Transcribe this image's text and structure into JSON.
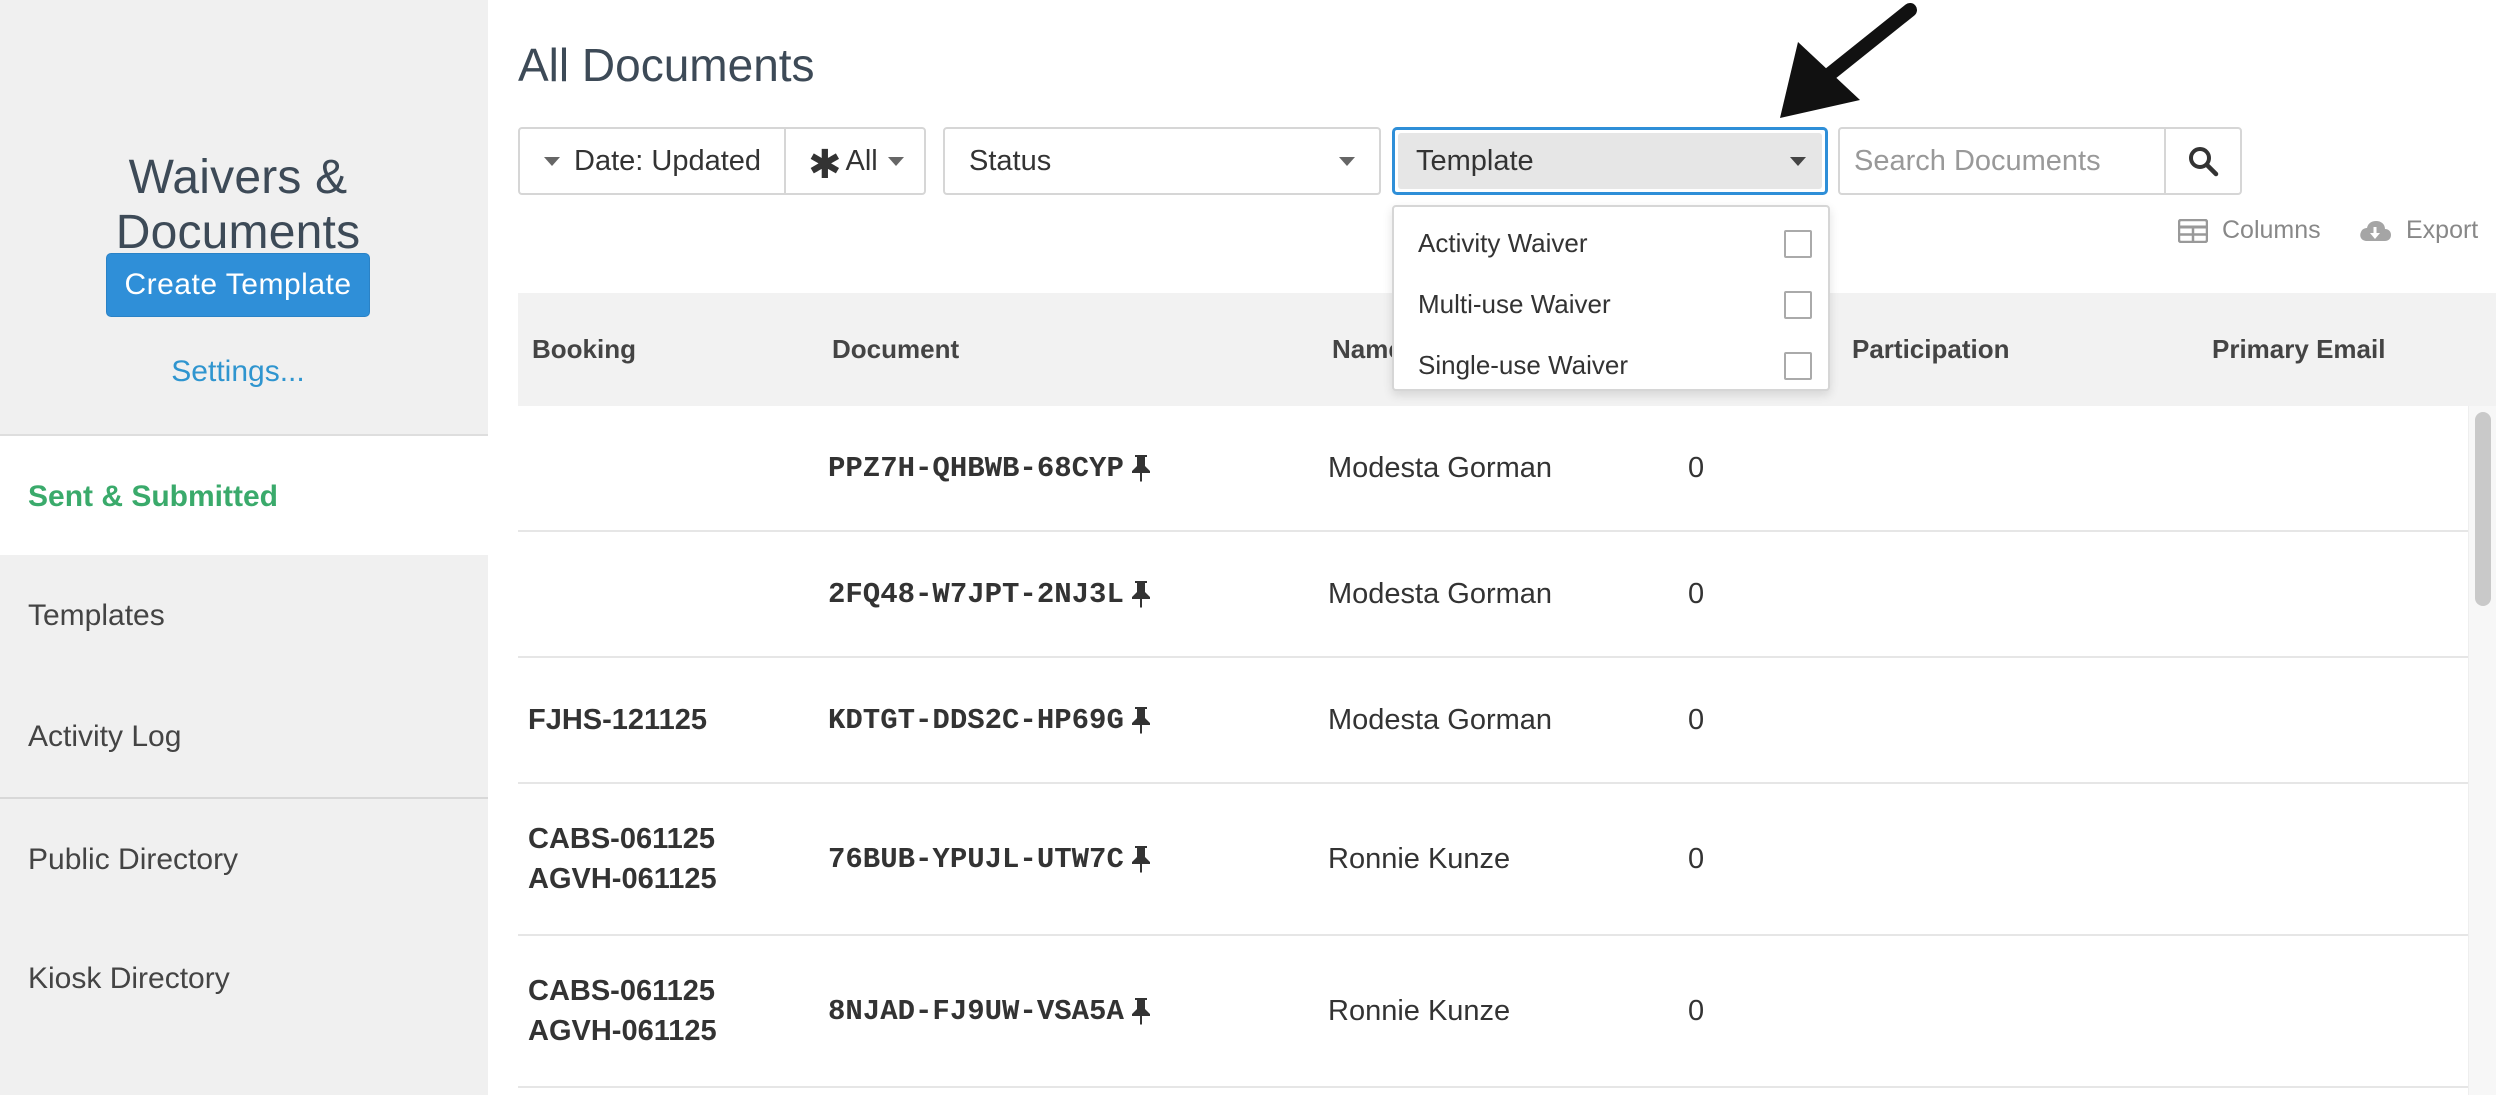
{
  "sidebar": {
    "title": "Waivers & Documents",
    "create_label": "Create Template",
    "settings_label": "Settings...",
    "nav": [
      {
        "label": "Sent & Submitted",
        "active": true
      },
      {
        "label": "Templates"
      },
      {
        "label": "Activity Log"
      },
      {
        "label": "Public Directory"
      },
      {
        "label": "Kiosk Directory"
      }
    ]
  },
  "main": {
    "title": "All Documents",
    "toolbar": {
      "date_label": "Date: Updated",
      "all_label": "All",
      "status_label": "Status",
      "template_label": "Template",
      "search_placeholder": "Search Documents",
      "columns_label": "Columns",
      "export_label": "Export"
    },
    "template_dropdown": {
      "options": [
        {
          "label": "Activity Waiver",
          "checked": false
        },
        {
          "label": "Multi-use Waiver",
          "checked": false
        },
        {
          "label": "Single-use Waiver",
          "checked": false
        }
      ]
    },
    "table": {
      "headers": {
        "booking": "Booking",
        "document": "Document",
        "name": "Name",
        "participation": "Participation",
        "email": "Primary Email"
      },
      "rows": [
        {
          "booking": [
            "",
            ""
          ],
          "document": "PPZ7H-QHBWB-68CYP",
          "name": "Modesta Gorman",
          "count": "0"
        },
        {
          "booking": [
            "",
            ""
          ],
          "document": "2FQ48-W7JPT-2NJ3L",
          "name": "Modesta Gorman",
          "count": "0"
        },
        {
          "booking": [
            "FJHS-121125",
            ""
          ],
          "document": "KDTGT-DDS2C-HP69G",
          "name": "Modesta Gorman",
          "count": "0"
        },
        {
          "booking": [
            "CABS-061125",
            "AGVH-061125"
          ],
          "document": "76BUB-YPUJL-UTW7C",
          "name": "Ronnie Kunze",
          "count": "0"
        },
        {
          "booking": [
            "CABS-061125",
            "AGVH-061125"
          ],
          "document": "8NJAD-FJ9UW-VSA5A",
          "name": "Ronnie Kunze",
          "count": "0"
        }
      ]
    }
  },
  "colors": {
    "primary": "#2f8fd8",
    "active_nav": "#3aaa6b",
    "link": "#2f95cf"
  },
  "icons": [
    "search-icon",
    "columns-icon",
    "cloud-download-icon",
    "pin-icon",
    "caret-down-icon",
    "arrow-annotation"
  ]
}
